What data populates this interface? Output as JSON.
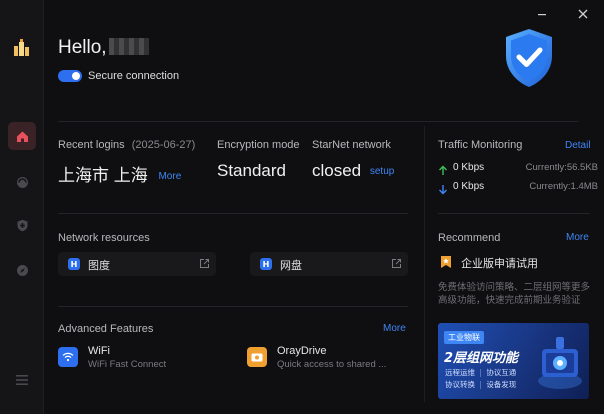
{
  "header": {
    "greeting": "Hello,",
    "secure_label": "Secure connection"
  },
  "login": {
    "label": "Recent logins",
    "date": "(2025-06-27)",
    "location": "上海市 上海",
    "more": "More"
  },
  "encryption": {
    "label": "Encryption mode",
    "value": "Standard"
  },
  "starnet": {
    "label": "StarNet network",
    "value": "closed",
    "setup": "setup"
  },
  "traffic": {
    "label": "Traffic Monitoring",
    "detail": "Detail",
    "up_rate": "0 Kbps",
    "up_total": "Currently:56.5KB",
    "down_rate": "0 Kbps",
    "down_total": "Currently:1.4MB"
  },
  "resources": {
    "label": "Network resources",
    "items": [
      {
        "name": "图度"
      },
      {
        "name": "网盘"
      }
    ]
  },
  "recommend": {
    "label": "Recommend",
    "more": "More",
    "trial_label": "企业版申请试用",
    "desc_line1": "免费体验访问策略、二层组网等更多",
    "desc_line2": "高级功能，快速完成前期业务验证",
    "banner": {
      "tag": "工业物联",
      "title": "2层组网功能",
      "features": [
        "远程运维",
        "协议互通",
        "协议转换",
        "设备发现"
      ]
    }
  },
  "features": {
    "label": "Advanced Features",
    "more": "More",
    "items": [
      {
        "title": "WiFi",
        "subtitle": "WiFi Fast Connect"
      },
      {
        "title": "OrayDrive",
        "subtitle": "Quick access to shared ..."
      }
    ]
  },
  "colors": {
    "accent": "#2e6ff0",
    "link": "#3f86f5",
    "up_arrow": "#3fbf5a",
    "down_arrow": "#3f86f5",
    "home_active": "#e8505b",
    "drive_icon": "#f0a030",
    "trial_icon": "#f0a030"
  }
}
